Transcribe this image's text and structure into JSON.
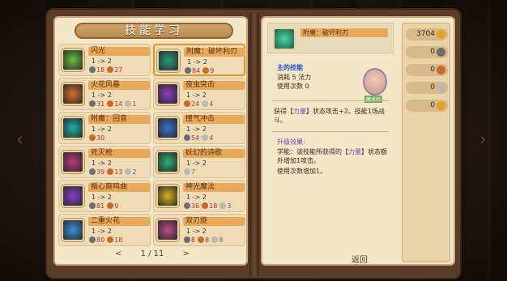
{
  "left": {
    "title": "技能学习",
    "pager": {
      "prev": "<",
      "page": "1 / 11",
      "next": ">"
    }
  },
  "skills": [
    {
      "name": "闪光",
      "level": "1 -> 2",
      "costs": [
        {
          "c": "c0",
          "v": "18",
          "cls": "ct"
        },
        {
          "c": "c1",
          "v": "27",
          "cls": "ct"
        }
      ],
      "icon_color": "#6bc13c"
    },
    {
      "name": "附魔：破坏利刃",
      "level": "1 -> 2",
      "costs": [
        {
          "c": "c0",
          "v": "84",
          "cls": "ct"
        },
        {
          "c": "c1",
          "v": "9",
          "cls": "ct"
        }
      ],
      "icon_color": "#2a9b7a",
      "selected": true
    },
    {
      "name": "火花风暴",
      "level": "1 -> 2",
      "costs": [
        {
          "c": "c0",
          "v": "31",
          "cls": "ct"
        },
        {
          "c": "c1",
          "v": "14",
          "cls": "ct"
        },
        {
          "c": "c2",
          "v": "1",
          "cls": "ct"
        }
      ],
      "icon_color": "#d8702e"
    },
    {
      "name": "夜虫突击",
      "level": "1 -> 2",
      "costs": [
        {
          "c": "c1",
          "v": "24",
          "cls": "ct"
        },
        {
          "c": "c2",
          "v": "4",
          "cls": "ct g"
        }
      ],
      "icon_color": "#8d3cc1"
    },
    {
      "name": "附魔：回音",
      "level": "1 -> 2",
      "costs": [
        {
          "c": "c1",
          "v": "30",
          "cls": "ct"
        }
      ],
      "icon_color": "#1fb0a8"
    },
    {
      "name": "撞气冲击",
      "level": "1 -> 2",
      "costs": [
        {
          "c": "c0",
          "v": "54",
          "cls": "ct"
        },
        {
          "c": "c2",
          "v": "4",
          "cls": "ct g"
        }
      ],
      "icon_color": "#3a6fd0"
    },
    {
      "name": "死灭枪",
      "level": "1 -> 2",
      "costs": [
        {
          "c": "c0",
          "v": "39",
          "cls": "ct"
        },
        {
          "c": "c1",
          "v": "13",
          "cls": "ct"
        },
        {
          "c": "c2",
          "v": "2",
          "cls": "ct g"
        }
      ],
      "icon_color": "#c23a7a"
    },
    {
      "name": "妖幻的诗歌",
      "level": "1 -> 2",
      "costs": [
        {
          "c": "c2",
          "v": "7",
          "cls": "ct g"
        }
      ],
      "icon_color": "#2fb070"
    },
    {
      "name": "叛心爽鸣曲",
      "level": "1 -> 2",
      "costs": [
        {
          "c": "c0",
          "v": "81",
          "cls": "ct"
        },
        {
          "c": "c1",
          "v": "9",
          "cls": "ct"
        }
      ],
      "icon_color": "#8a3cc8"
    },
    {
      "name": "神光魔法",
      "level": "1 -> 2",
      "costs": [
        {
          "c": "c0",
          "v": "36",
          "cls": "ct"
        },
        {
          "c": "c1",
          "v": "18",
          "cls": "ct"
        },
        {
          "c": "c2",
          "v": "3",
          "cls": "ct g"
        }
      ],
      "icon_color": "#d8b21c"
    },
    {
      "name": "二重火花",
      "level": "1 -> 2",
      "costs": [
        {
          "c": "c0",
          "v": "80",
          "cls": "ct"
        },
        {
          "c": "c1",
          "v": "18",
          "cls": "ct"
        }
      ],
      "icon_color": "#3a8fd8"
    },
    {
      "name": "双刃旋",
      "level": "1 -> 2",
      "costs": [
        {
          "c": "c0",
          "v": "8",
          "cls": "ct"
        },
        {
          "c": "c1",
          "v": "8",
          "cls": "ct"
        },
        {
          "c": "c2",
          "v": "8",
          "cls": "ct g"
        }
      ],
      "icon_color": "#c04a8a"
    }
  ],
  "detail": {
    "name": "附魔：破坏利刃",
    "owner_label": "主的技能",
    "cost_label": "消耗 5 法力",
    "uses_label": "使用次数 0",
    "avatar_tag": "魔术师",
    "desc1": "获得【",
    "desc_item": "力量",
    "desc2": "】状态攻击+2。技能1场战斗。",
    "upgrade_title": "升级效果:",
    "upgrade1": "学能：该技能所获得的【",
    "upgrade_item": "力量",
    "upgrade2": "】状态额外增加1攻击。",
    "upgrade3": "使用次数增加1。"
  },
  "resources": [
    {
      "v": "3704",
      "c": "c3"
    },
    {
      "v": "0",
      "c": "c0"
    },
    {
      "v": "0",
      "c": "c1"
    },
    {
      "v": "0",
      "c": "c2"
    },
    {
      "v": "0",
      "c": "c3"
    }
  ],
  "right": {
    "back": "返回"
  }
}
